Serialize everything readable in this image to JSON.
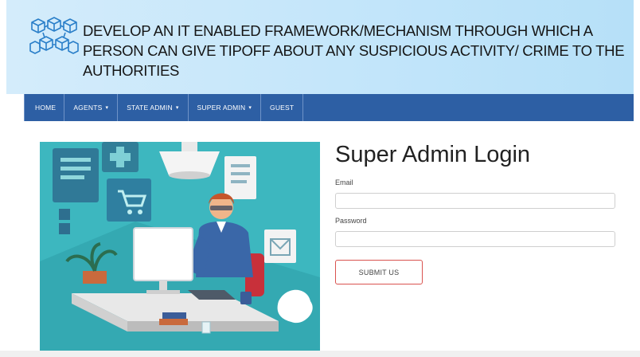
{
  "header": {
    "title": "DEVELOP AN IT ENABLED FRAMEWORK/MECHANISM THROUGH WHICH A PERSON CAN GIVE TIPOFF ABOUT ANY SUSPICIOUS ACTIVITY/ CRIME TO THE AUTHORITIES",
    "logo_icon": "network-cubes-icon"
  },
  "nav": {
    "items": [
      {
        "label": "HOME",
        "has_dropdown": false
      },
      {
        "label": "AGENTS",
        "has_dropdown": true
      },
      {
        "label": "STATE ADMIN",
        "has_dropdown": true
      },
      {
        "label": "SUPER ADMIN",
        "has_dropdown": true
      },
      {
        "label": "GUEST",
        "has_dropdown": false
      }
    ],
    "caret": "▾"
  },
  "login": {
    "title": "Super Admin Login",
    "email_label": "Email",
    "email_value": "",
    "password_label": "Password",
    "password_value": "",
    "submit_label": "SUBMIT US"
  },
  "colors": {
    "nav_bg": "#2d5fa4",
    "header_bg": "#c8e8fb",
    "submit_border": "#d9534f",
    "illustration_bg": "#3fb8c0"
  },
  "illustration": {
    "icon": "person-at-computer-illustration"
  }
}
